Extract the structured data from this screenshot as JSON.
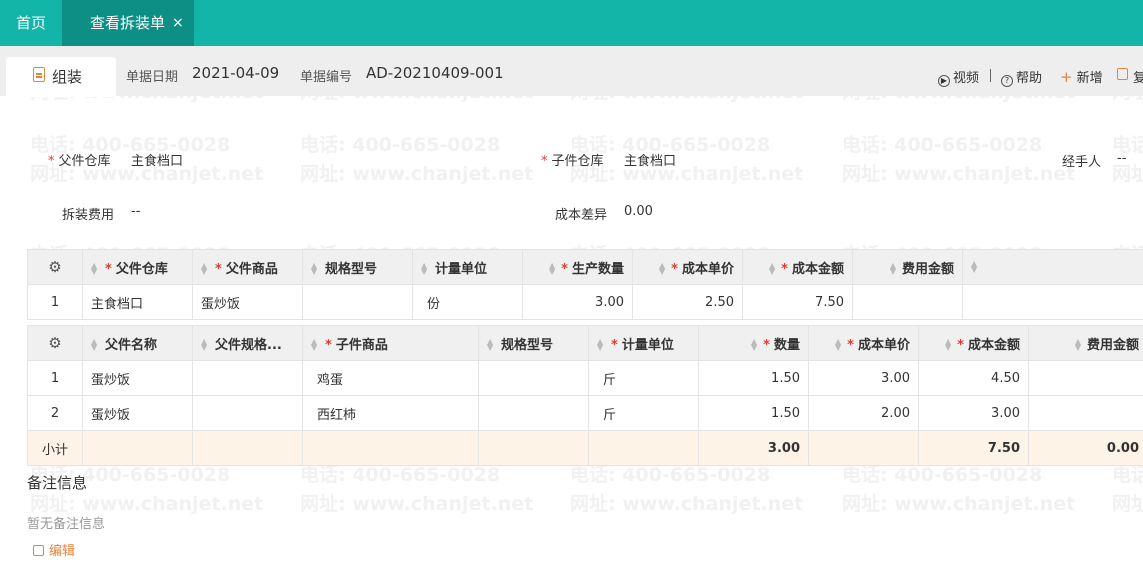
{
  "tabs": {
    "home": "首页",
    "active": "查看拆装单",
    "close": "×"
  },
  "module": {
    "label": "组装",
    "icon": "document-icon"
  },
  "header": {
    "date_label": "单据日期",
    "date": "2021-04-09",
    "code_label": "单据编号",
    "code": "AD-20210409-001"
  },
  "toolbar": {
    "video": "视频",
    "help": "帮助",
    "add": "新增",
    "copy": "复"
  },
  "form": {
    "parent_wh_label": "父件仓库",
    "parent_wh": "主食档口",
    "child_wh_label": "子件仓库",
    "child_wh": "主食档口",
    "handler_label": "经手人",
    "handler": "--",
    "fee_label": "拆装费用",
    "fee": "--",
    "cost_diff_label": "成本差异",
    "cost_diff": "0.00"
  },
  "parent_table": {
    "headers": [
      "父件仓库",
      "父件商品",
      "规格型号",
      "计量单位",
      "生产数量",
      "成本单价",
      "成本金额",
      "费用金额"
    ],
    "rows": [
      [
        "1",
        "主食档口",
        "蛋炒饭",
        "",
        "份",
        "3.00",
        "2.50",
        "7.50",
        "",
        ""
      ]
    ]
  },
  "child_table": {
    "headers": [
      "父件名称",
      "父件规格...",
      "子件商品",
      "规格型号",
      "计量单位",
      "数量",
      "成本单价",
      "成本金额",
      "费用金额"
    ],
    "rows": [
      [
        "1",
        "蛋炒饭",
        "",
        "鸡蛋",
        "",
        "斤",
        "1.50",
        "3.00",
        "4.50",
        ""
      ],
      [
        "2",
        "蛋炒饭",
        "",
        "西红柿",
        "",
        "斤",
        "1.50",
        "2.00",
        "3.00",
        ""
      ]
    ],
    "subtotal": {
      "label": "小计",
      "qty": "3.00",
      "amount": "7.50",
      "fee": "0.00"
    }
  },
  "memo": {
    "title": "备注信息",
    "empty": "暂无备注信息",
    "edit": "编辑"
  },
  "watermark": {
    "phone": "电话: 400-665-0028",
    "site": "网址: www.chanjet.net"
  }
}
